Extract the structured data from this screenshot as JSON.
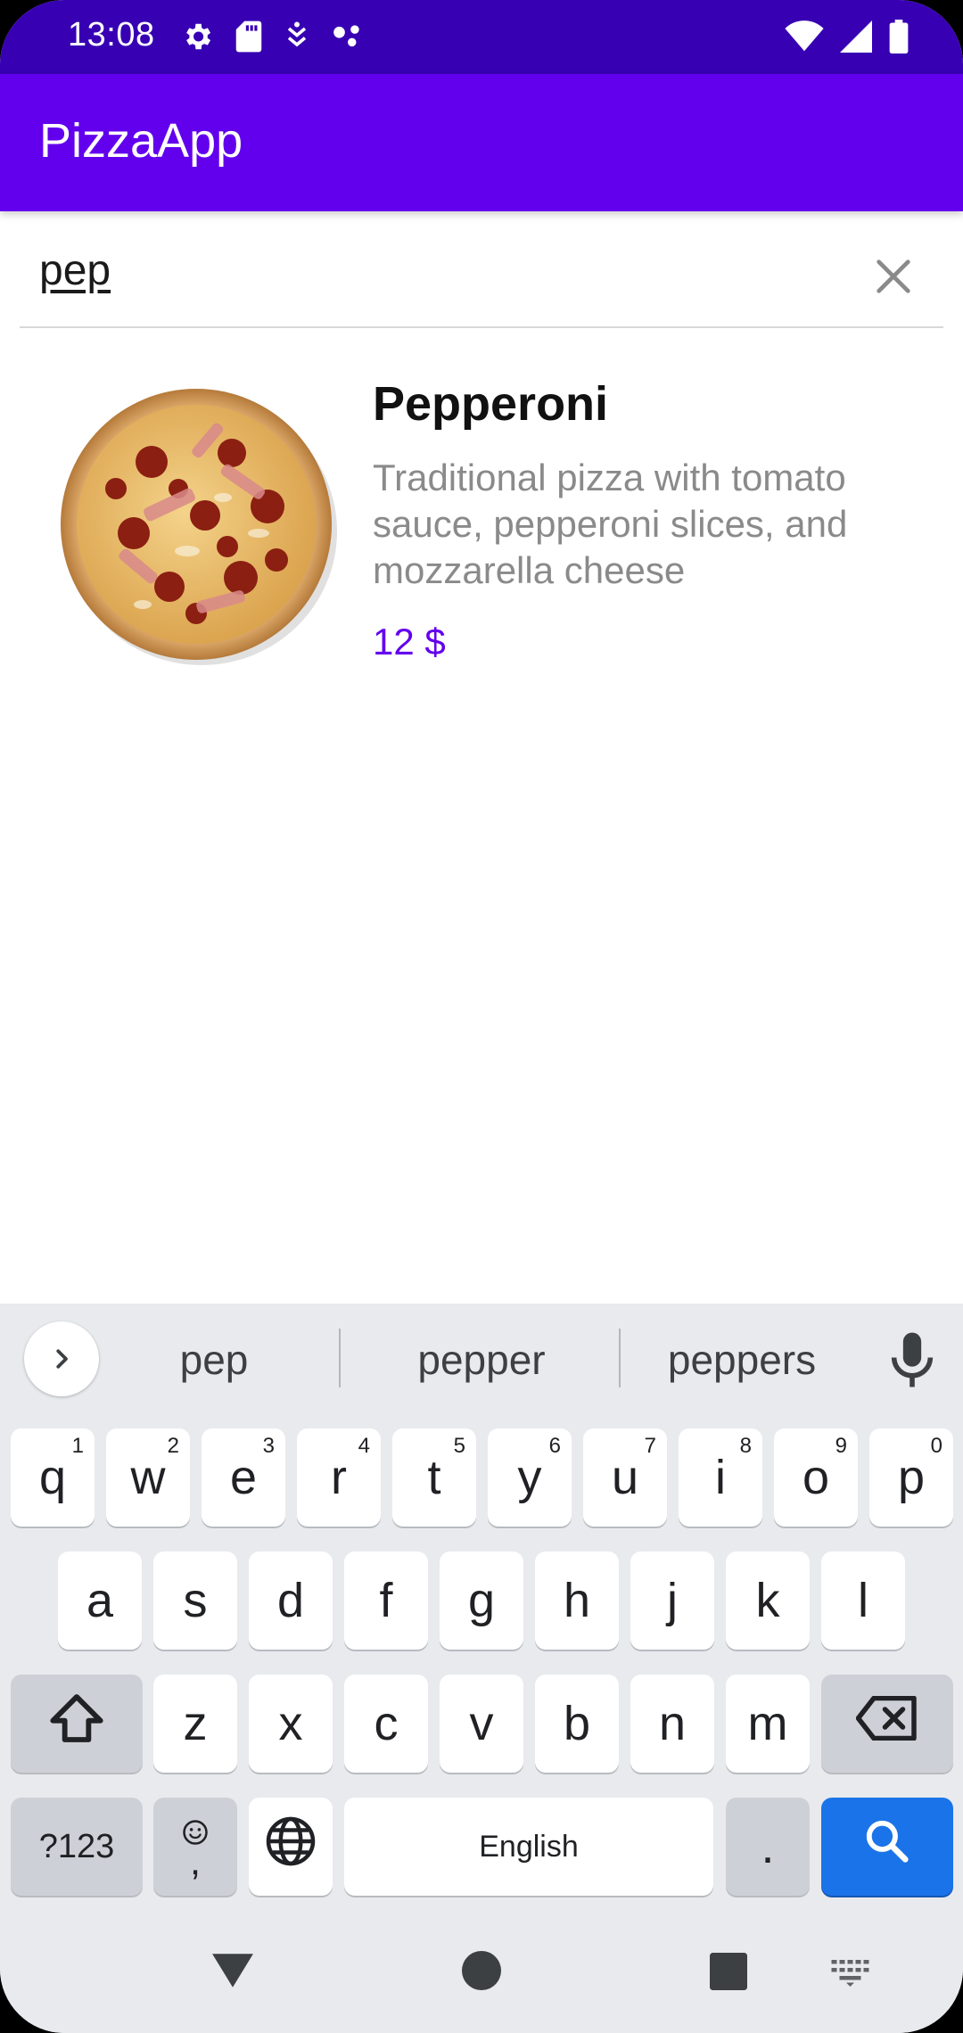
{
  "status_bar": {
    "time": "13:08",
    "left_icons": [
      "gear-icon",
      "sd-card-icon",
      "usb-debug-icon",
      "assistant-icon"
    ],
    "right_icons": [
      "wifi-icon",
      "signal-icon",
      "battery-icon"
    ]
  },
  "app_bar": {
    "title": "PizzaApp",
    "color": "#6200ee",
    "status_color": "#3700b3"
  },
  "search": {
    "value": "pep",
    "clear_icon": "close-icon"
  },
  "results": [
    {
      "title": "Pepperoni",
      "description": "Traditional pizza with tomato sauce, pepperoni slices, and mozzarella cheese",
      "price": "12 $",
      "image_icon": "pizza-image"
    }
  ],
  "keyboard": {
    "suggestions": [
      "pep",
      "pepper",
      "peppers"
    ],
    "row1": [
      {
        "k": "q",
        "n": "1"
      },
      {
        "k": "w",
        "n": "2"
      },
      {
        "k": "e",
        "n": "3"
      },
      {
        "k": "r",
        "n": "4"
      },
      {
        "k": "t",
        "n": "5"
      },
      {
        "k": "y",
        "n": "6"
      },
      {
        "k": "u",
        "n": "7"
      },
      {
        "k": "i",
        "n": "8"
      },
      {
        "k": "o",
        "n": "9"
      },
      {
        "k": "p",
        "n": "0"
      }
    ],
    "row2": [
      "a",
      "s",
      "d",
      "f",
      "g",
      "h",
      "j",
      "k",
      "l"
    ],
    "row3": [
      "z",
      "x",
      "c",
      "v",
      "b",
      "n",
      "m"
    ],
    "symbols_label": "?123",
    "emoji_comma": ",",
    "space_label": "English",
    "period_label": ".",
    "action_color": "#1a73e8"
  },
  "nav_bar": {
    "icons": [
      "back-icon",
      "home-icon",
      "recents-icon",
      "keyboard-switch-icon"
    ]
  }
}
